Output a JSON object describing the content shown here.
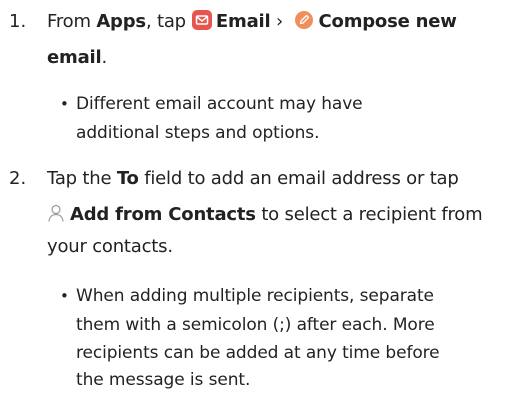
{
  "steps": [
    {
      "number": "1.",
      "line1": {
        "pre": "From ",
        "apps": "Apps",
        "mid": ", tap",
        "email": "Email",
        "sep": " › ",
        "compose": "Compose new"
      },
      "line2": {
        "compose_cont": "email",
        "end": "."
      },
      "bullet": {
        "line1": "Different email account may have",
        "line2": "additional steps and options."
      }
    },
    {
      "number": "2.",
      "line1": {
        "pre": "Tap the ",
        "to": "To",
        "post": " field to add an email address or tap"
      },
      "line2": {
        "add": "Add from Contacts",
        "post": " to select a recipient from"
      },
      "line3": "your contacts.",
      "bullet": {
        "line1": "When adding multiple recipients, separate",
        "line2": "them with a semicolon (;) after each. More",
        "line3": "recipients can be added at any time before",
        "line4": "the message is sent."
      }
    }
  ],
  "bullet_symbol": "•",
  "icons": {
    "email": {
      "name": "email-envelope-icon",
      "color": "#e8554e"
    },
    "compose": {
      "name": "compose-pencil-icon",
      "color": "#f08f59"
    },
    "contact": {
      "name": "add-contact-person-icon",
      "color": "#9a9a9a"
    }
  },
  "colors": {
    "text": "#222222"
  }
}
